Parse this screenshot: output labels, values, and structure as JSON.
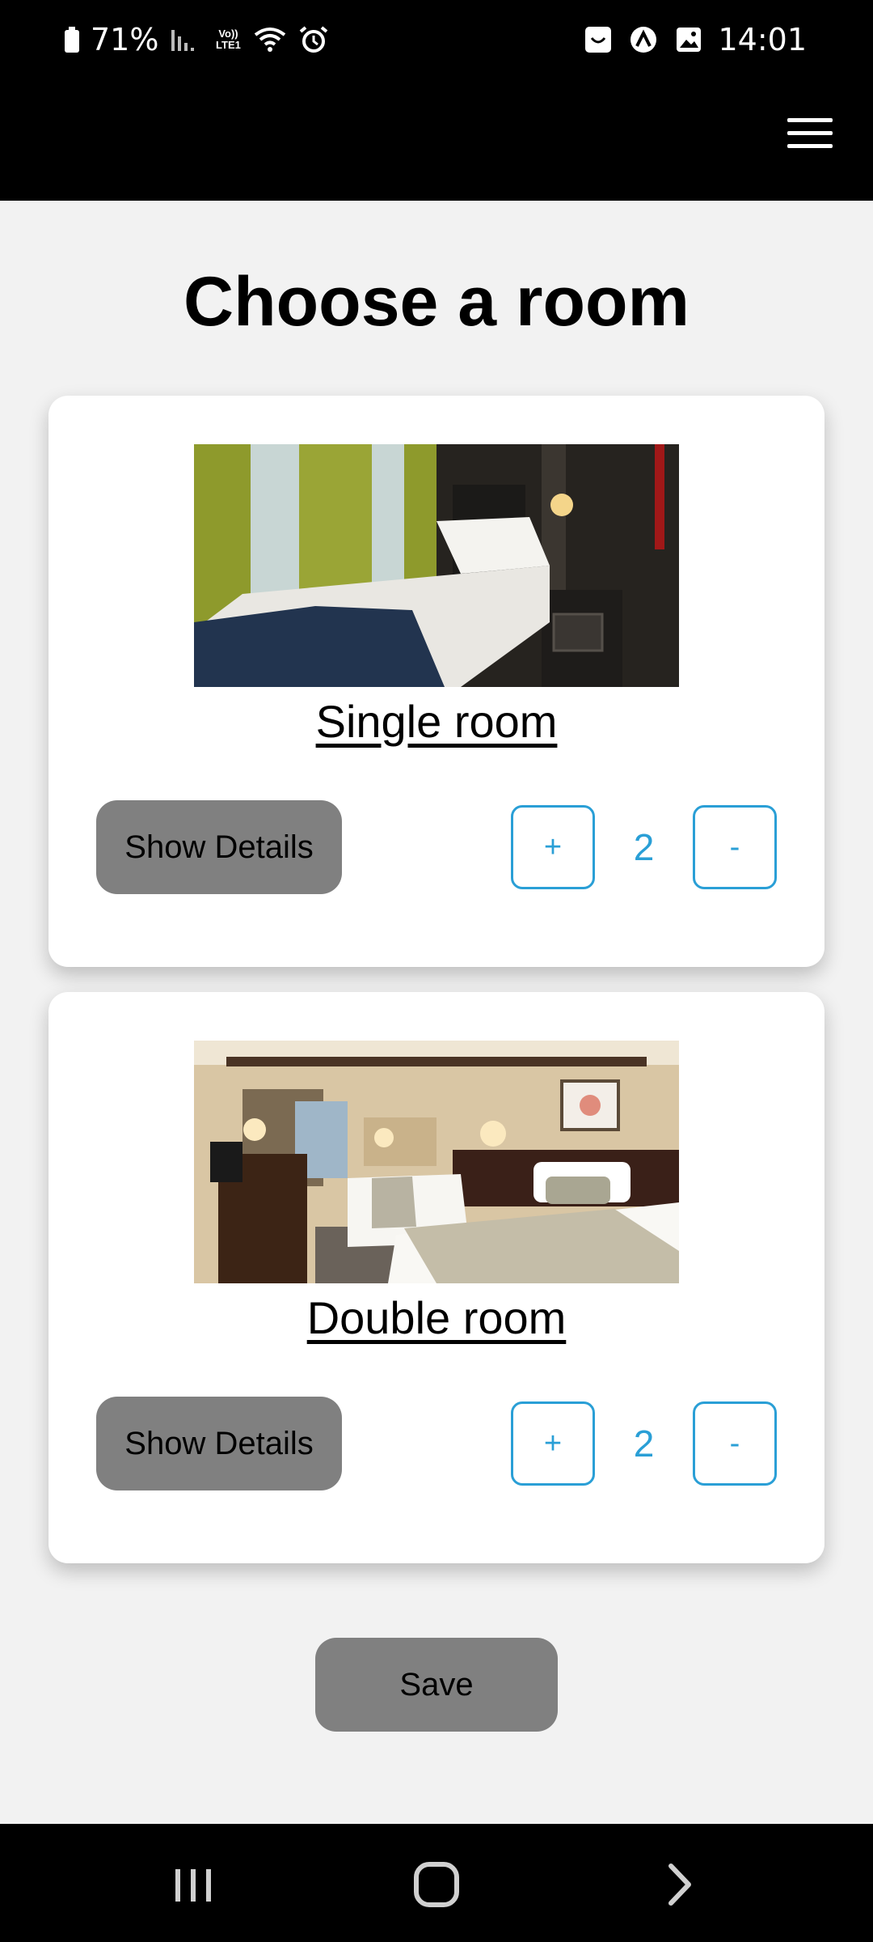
{
  "status_bar": {
    "battery": "71%",
    "network_label": "Vo)) LTE1",
    "time": "14:01",
    "icons": [
      "battery-icon",
      "signal-icon",
      "wifi-icon",
      "alarm-icon",
      "shopping-bag-icon",
      "app-icon",
      "gallery-icon"
    ]
  },
  "header": {
    "menu_icon": "hamburger-menu-icon"
  },
  "page": {
    "title": "Choose a room"
  },
  "rooms": [
    {
      "name": "Single room",
      "details_label": "Show Details",
      "plus_label": "+",
      "quantity": "2",
      "minus_label": "-"
    },
    {
      "name": "Double room",
      "details_label": "Show Details",
      "plus_label": "+",
      "quantity": "2",
      "minus_label": "-"
    }
  ],
  "save_label": "Save",
  "colors": {
    "accent": "#2a9fd6",
    "button_gray": "#808080",
    "background": "#f2f2f2",
    "bars": "#000000"
  },
  "nav_bar": {
    "icons": [
      "recents-icon",
      "home-icon",
      "back-icon"
    ]
  }
}
